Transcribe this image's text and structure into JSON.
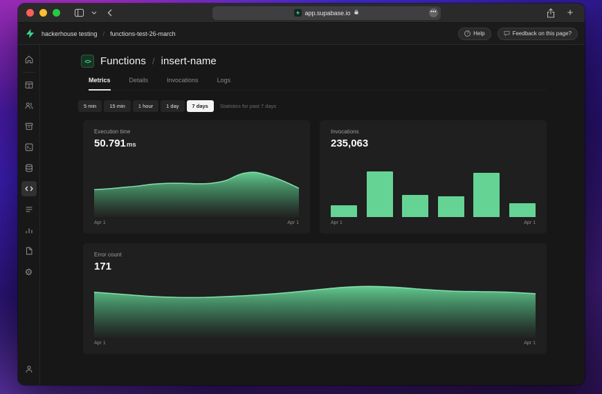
{
  "colors": {
    "accent_green": "#3ecf8e",
    "chart_green": "#65d394",
    "chart_stroke": "#8ae6b4",
    "traffic_red": "#ff5f57",
    "traffic_yellow": "#febc2e",
    "traffic_green": "#28c840"
  },
  "browser": {
    "url": "app.supabase.io",
    "ellipsis": "•••",
    "plus_label": "+"
  },
  "app_header": {
    "breadcrumb": [
      {
        "label": "hackerhouse testing"
      },
      {
        "label": "functions-test-26-march"
      }
    ],
    "separator": "/",
    "help_label": "Help",
    "help_icon_glyph": "?",
    "feedback_label": "Feedback on this page?"
  },
  "sidebar": {
    "items": [
      "home",
      "table-editor",
      "authentication",
      "storage",
      "sql-editor",
      "database",
      "edge-functions",
      "logs",
      "reports",
      "docs",
      "settings"
    ],
    "active": "edge-functions",
    "bottom": [
      "account"
    ],
    "settings_glyph": "⚙"
  },
  "page": {
    "title_icon": "code-icon",
    "title_icon_glyph": "<>",
    "title_primary": "Functions",
    "title_separator": "/",
    "title_secondary": "insert-name",
    "tabs": [
      {
        "label": "Metrics",
        "active": true
      },
      {
        "label": "Details",
        "active": false
      },
      {
        "label": "Invocations",
        "active": false
      },
      {
        "label": "Logs",
        "active": false
      }
    ],
    "time_ranges": [
      {
        "label": "5 min",
        "active": false
      },
      {
        "label": "15 min",
        "active": false
      },
      {
        "label": "1 hour",
        "active": false
      },
      {
        "label": "1 day",
        "active": false
      },
      {
        "label": "7 days",
        "active": true
      }
    ],
    "time_note": "Statistics for past 7 days"
  },
  "chart_data": [
    {
      "type": "area",
      "title": "Execution time",
      "value": "50.791",
      "unit": "ms",
      "x_labels": [
        "Apr 1",
        "Apr 1"
      ],
      "xlabel": "",
      "ylabel": "",
      "grid": false,
      "legend": false,
      "series_normalized": [
        0.6,
        0.62,
        0.65,
        0.68,
        0.72,
        0.74,
        0.74,
        0.73,
        0.74,
        0.8,
        0.94,
        0.98,
        0.9,
        0.78,
        0.63
      ]
    },
    {
      "type": "bar",
      "title": "Invocations",
      "value": "235,063",
      "unit": "",
      "x_labels": [
        "Apr 1",
        "Apr 1"
      ],
      "xlabel": "",
      "ylabel": "",
      "grid": false,
      "legend": false,
      "values_normalized": [
        0.26,
        1.0,
        0.48,
        0.45,
        0.97,
        0.31
      ]
    },
    {
      "type": "area",
      "title": "Error count",
      "value": "171",
      "unit": "",
      "x_labels": [
        "Apr 1",
        "Apr 1"
      ],
      "xlabel": "",
      "ylabel": "",
      "grid": false,
      "legend": false,
      "series_normalized": [
        0.86,
        0.82,
        0.78,
        0.76,
        0.76,
        0.78,
        0.81,
        0.85,
        0.9,
        0.95,
        0.97,
        0.95,
        0.91,
        0.88,
        0.87,
        0.86,
        0.83
      ]
    }
  ]
}
